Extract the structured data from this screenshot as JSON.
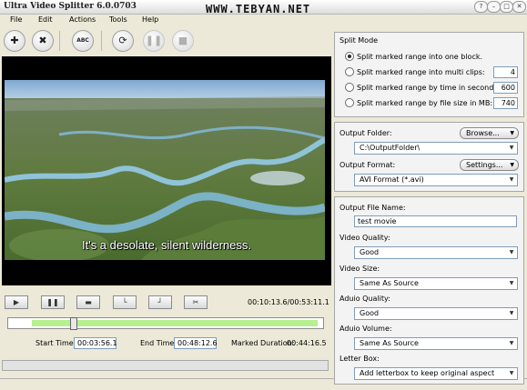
{
  "app_title": "Ultra Video Splitter 6.0.0703",
  "watermark": "WWW.TEBYAN.NET",
  "window_buttons": [
    "?",
    "–",
    "□",
    "✕"
  ],
  "menu": [
    "File",
    "Edit",
    "Actions",
    "Tools",
    "Help"
  ],
  "toolbar": {
    "abc_label": "ABC"
  },
  "video": {
    "subtitle": "It's a desolate, silent wilderness."
  },
  "controls": {
    "timecode": "00:10:13.6/00:53:11.1",
    "slider_fraction": 0.2,
    "start_time_label": "Start Time:",
    "start_time": "00:03:56.1",
    "end_time_label": "End Time:",
    "end_time": "00:48:12.6",
    "marked_duration_label": "Marked Duration:",
    "marked_duration": "00:44:16.5"
  },
  "split_mode": {
    "title": "Split Mode",
    "options": [
      {
        "label": "Split  marked range into one block.",
        "selected": true,
        "value": ""
      },
      {
        "label": "Split marked range into multi clips:",
        "selected": false,
        "value": "4"
      },
      {
        "label": "Split marked range by time in seconds:",
        "selected": false,
        "value": "600"
      },
      {
        "label": "Split marked range by file size in MB:",
        "selected": false,
        "value": "740"
      }
    ]
  },
  "output": {
    "folder_label": "Output Folder:",
    "browse_label": "Browse...",
    "folder_value": "C:\\OutputFolder\\",
    "format_label": "Output Format:",
    "settings_label": "Settings...",
    "format_value": "AVI Format (*.avi)"
  },
  "options": {
    "file_name_label": "Output File Name:",
    "file_name_value": "test movie",
    "video_quality_label": "Video Quality:",
    "video_quality_value": "Good",
    "video_size_label": "Video Size:",
    "video_size_value": "Same As Source",
    "audio_quality_label": "Aduio Quality:",
    "audio_quality_value": "Good",
    "audio_volume_label": "Aduio Volume:",
    "audio_volume_value": "Same As Source",
    "letterbox_label": "Letter Box:",
    "letterbox_value": "Add letterbox to keep original aspect"
  },
  "colors": {
    "slider_fill": "#b6f08f",
    "field_border": "#7f9db9",
    "video_bg": "#000000"
  }
}
